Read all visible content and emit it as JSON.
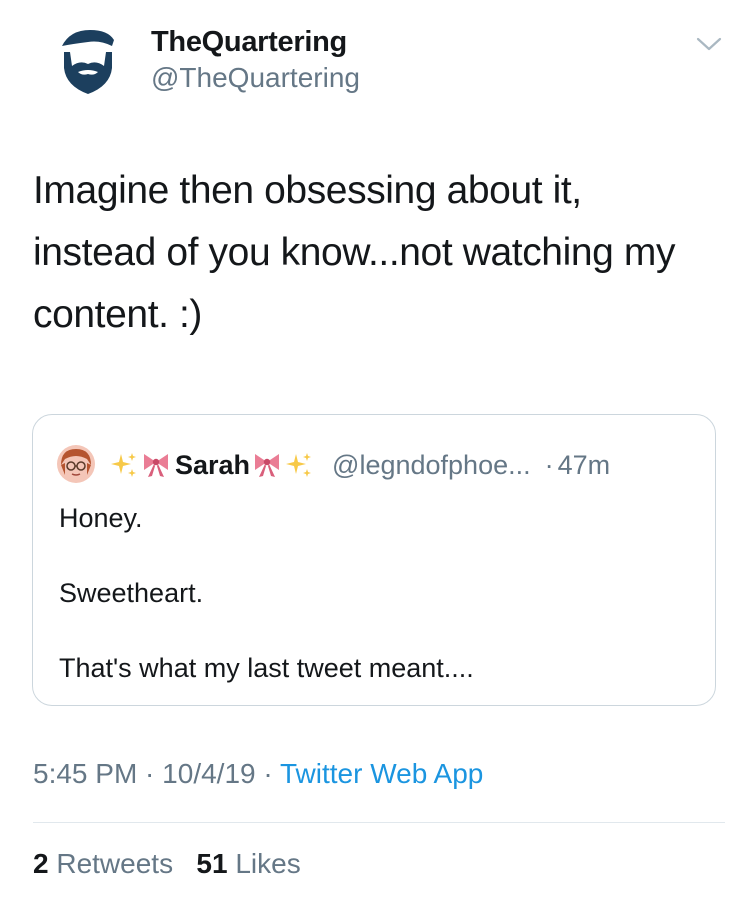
{
  "author": {
    "display_name": "TheQuartering",
    "handle": "@TheQuartering",
    "avatar_icon": "bearded-man-logo-icon",
    "avatar_color": "#1c3f5e"
  },
  "menu_icon": "chevron-down-icon",
  "tweet": {
    "lines": [
      "Imagine then obsessing about it,",
      "instead of you know...not watching my",
      "content. :)"
    ]
  },
  "quoted_tweet": {
    "avatar_icon": "cartoon-avatar-icon",
    "name_prefix_emoji": [
      "sparkles-icon",
      "ribbon-icon"
    ],
    "display_name": "Sarah",
    "name_suffix_emoji": [
      "ribbon-icon",
      "sparkles-icon"
    ],
    "handle": "@legndofphoe...",
    "dot": "·",
    "time": "47m",
    "lines": [
      "Honey.",
      "Sweetheart.",
      "That's what my last tweet meant...."
    ]
  },
  "meta": {
    "time": "5:45 PM",
    "sep1": " · ",
    "date": "10/4/19",
    "sep2": " · ",
    "source": "Twitter Web App"
  },
  "stats": {
    "retweets_count": "2",
    "retweets_label": "Retweets",
    "likes_count": "51",
    "likes_label": "Likes"
  },
  "colors": {
    "text": "#14171a",
    "secondary": "#657786",
    "link": "#1b95e0",
    "border": "#ccd6dd"
  }
}
